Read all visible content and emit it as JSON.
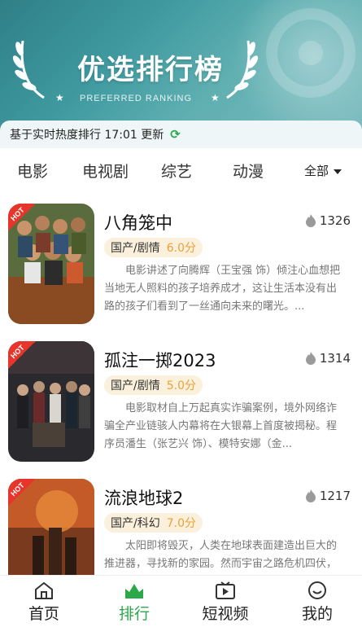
{
  "banner": {
    "title": "优选排行榜",
    "subtitle": "PREFERRED RANKING"
  },
  "info": {
    "text": "基于实时热度排行 17:01 更新"
  },
  "categories": {
    "tabs": [
      "电影",
      "电视剧",
      "综艺",
      "动漫"
    ],
    "all_label": "全部"
  },
  "badge_text": "HOT",
  "movies": [
    {
      "title": "八角笼中",
      "heat": "1326",
      "genre": "国产/剧情",
      "score": "6.0分",
      "description": "电影讲述了向腾辉（王宝强 饰）倾注心血想把当地无人照料的孩子培养成才，这让生活本没有出路的孩子们看到了一丝通向未来的曙光。..."
    },
    {
      "title": "孤注一掷2023",
      "heat": "1314",
      "genre": "国产/剧情",
      "score": "5.0分",
      "description": "电影取材自上万起真实诈骗案例，境外网络诈骗全产业链骇人内幕将在大银幕上首度被揭秘。程序员潘生（张艺兴 饰）、模特安娜（金..."
    },
    {
      "title": "流浪地球2",
      "heat": "1217",
      "genre": "国产/科幻",
      "score": "7.0分",
      "description": "太阳即将毁灭，人类在地球表面建造出巨大的推进器，寻找新的家园。然而宇宙之路危机四伏，为了拯救地球，流浪地球时代的年轻人..."
    }
  ],
  "nav": {
    "items": [
      "首页",
      "排行",
      "短视频",
      "我的"
    ]
  },
  "colors": {
    "accent": "#2aa84a",
    "score": "#e8a23a",
    "hot": "#e8352b",
    "banner": "#3f9aa0"
  }
}
